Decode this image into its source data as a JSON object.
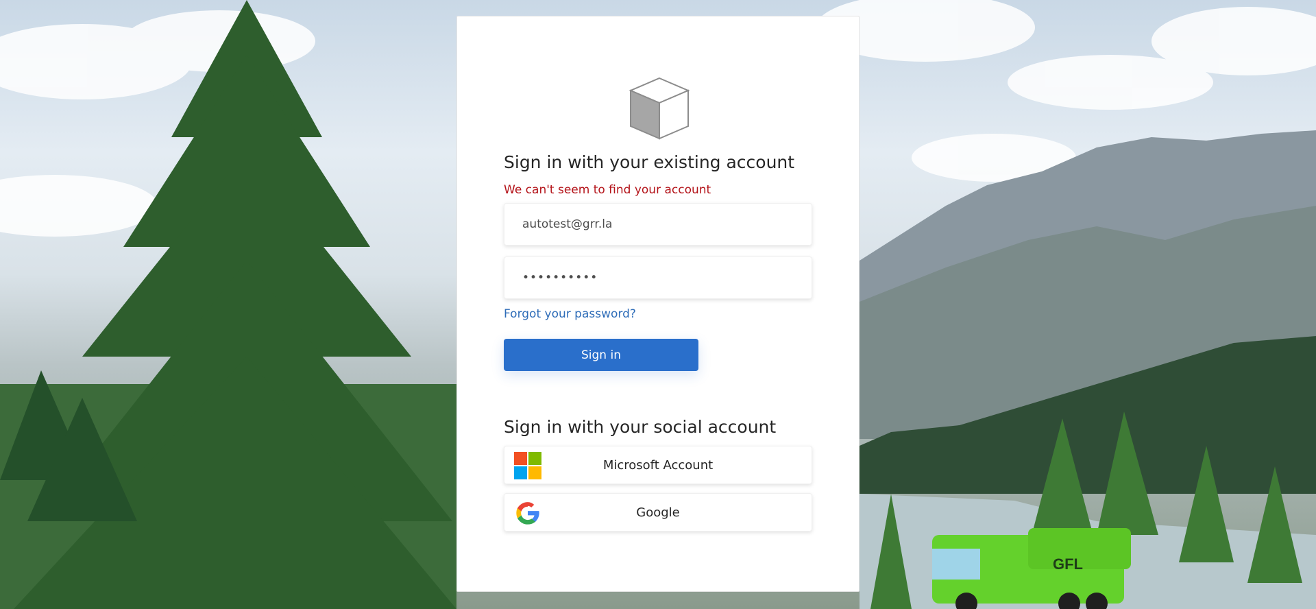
{
  "background": {
    "truck_logo_text": "GFL"
  },
  "card": {
    "logo_icon": "cube-icon",
    "existing_heading": "Sign in with your existing account",
    "error_message": "We can't seem to find your account",
    "email_value": "autotest@grr.la",
    "password_value": "••••••••••",
    "forgot_label": "Forgot your password?",
    "signin_label": "Sign in",
    "social_heading": "Sign in with your social account",
    "social_buttons": [
      {
        "label": "Microsoft Account",
        "icon": "microsoft-logo-icon"
      },
      {
        "label": "Google",
        "icon": "google-logo-icon"
      }
    ]
  },
  "colors": {
    "accent": "#2a6fcb",
    "error": "#b4141a",
    "link": "#2f6db8"
  }
}
